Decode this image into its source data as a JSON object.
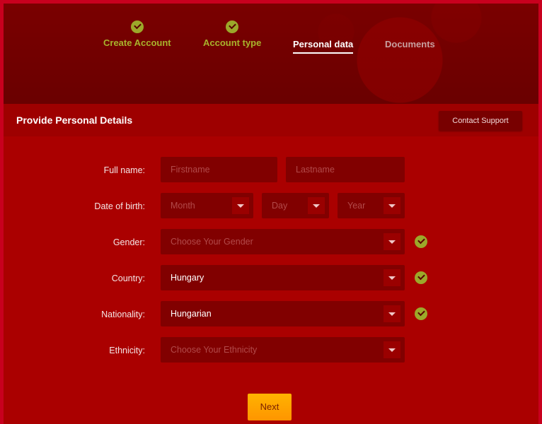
{
  "steps": [
    {
      "label": "Create Account",
      "state": "done"
    },
    {
      "label": "Account type",
      "state": "done"
    },
    {
      "label": "Personal data",
      "state": "active"
    },
    {
      "label": "Documents",
      "state": "todo"
    }
  ],
  "section": {
    "title": "Provide Personal Details",
    "support_label": "Contact Support"
  },
  "form": {
    "full_name": {
      "label": "Full name:",
      "first_placeholder": "Firstname",
      "last_placeholder": "Lastname"
    },
    "dob": {
      "label": "Date of birth:",
      "month_placeholder": "Month",
      "day_placeholder": "Day",
      "year_placeholder": "Year"
    },
    "gender": {
      "label": "Gender:",
      "placeholder": "Choose Your Gender",
      "valid": true
    },
    "country": {
      "label": "Country:",
      "value": "Hungary",
      "valid": true
    },
    "nationality": {
      "label": "Nationality:",
      "value": "Hungarian",
      "valid": true
    },
    "ethnicity": {
      "label": "Ethnicity:",
      "placeholder": "Choose Your Ethnicity"
    }
  },
  "actions": {
    "next_label": "Next"
  },
  "colors": {
    "accent": "#ff9f00",
    "success": "#9ca82a",
    "background": "#aa0000"
  }
}
